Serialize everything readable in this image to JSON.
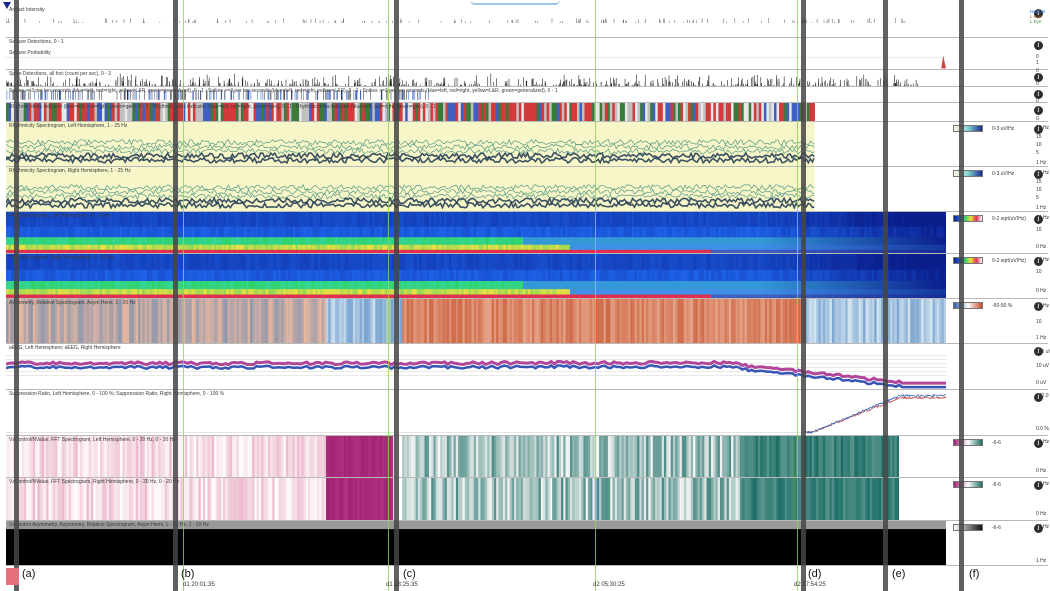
{
  "panels": [
    {
      "id": "artifact",
      "title": "Artifact Intensity",
      "ticks": []
    },
    {
      "id": "seizure",
      "title": "Seizure Detections, 0 - 1",
      "title2": "Seizure Probability",
      "ticks": [
        "1",
        "0",
        "1",
        "0"
      ]
    },
    {
      "id": "spike-detect",
      "title": "Spike Detections, all foci (count per sec), 0 - 3",
      "ticks": [
        "3",
        "0"
      ]
    },
    {
      "id": "spikes",
      "title": "Spikes >=3 per ten seconds (blue=left, red=right, yellow=L&R, green=generalized), 0 - 1 ; Spikes >=3 per ten seconds (blue=left, red=right, yellow=L&R), 0 - 1 ; Spikes >=3 per ten seconds (blue=left, red=right, yellow=L&R, green=generalized), 0 - 1",
      "ticks": [
        "1",
        "0"
      ]
    },
    {
      "id": "rhythmic",
      "title": "Rhythmic delta indicator (blue=left, red=right, green=gen), 0 - 1 ; Rhythmic delta indicator (blue=left, red=right, green=gen), 0 - 1 ; Rhythmic delta indicator (blue=left, red=right, green=gen), 0 - 1",
      "ticks": [
        "1",
        "0"
      ]
    },
    {
      "id": "rhythm-left",
      "title": "Rhythmicity Spectrogram, Left Hemisphere, 1 - 25 Hz",
      "ticks": [
        "25 Hz",
        "15",
        "10",
        "5",
        "1 Hz"
      ],
      "scale": "0-3 uV/Hz"
    },
    {
      "id": "rhythm-right",
      "title": "Rhythmicity Spectrogram, Right Hemisphere, 1 - 25 Hz",
      "ticks": [
        "25 Hz",
        "15",
        "10",
        "5",
        "1 Hz"
      ],
      "scale": "0-3 uV/Hz"
    },
    {
      "id": "fft-left",
      "title": "FFT Spectrogram, Left Hemisphere, 0 - 20 Hz",
      "ticks": [
        "20 Hz",
        "10",
        "0 Hz"
      ],
      "scale": "0-2 sqrt(uV/Hz)"
    },
    {
      "id": "fft-right",
      "title": "FFT Spectrogram, Right Hemisphere, 0 - 20 Hz",
      "ticks": [
        "20 Hz",
        "10",
        "0 Hz"
      ],
      "scale": "0-2 sqrt(uV/Hz)"
    },
    {
      "id": "asym",
      "title": "Asymmetry, Relative Spectrogram, Asym Hemi, 1 - 20 Hz",
      "ticks": [
        "20 Hz",
        "10",
        "1 Hz"
      ],
      "scale": "-50-50 %"
    },
    {
      "id": "aeeg",
      "title": "aEEG, Left Hemisphere; aEEG, Right Hemisphere",
      "ticks": [
        "100 uV",
        "10 uV",
        "0 uV"
      ]
    },
    {
      "id": "suppression",
      "title": "Suppression Ratio, Left Hemisphere, 0 - 100 %; Suppression Ratio, Right Hemisphere, 0 - 100 %",
      "ticks": [
        "100.0 %",
        "0.0 %"
      ]
    },
    {
      "id": "vs-left",
      "title": "VsControl/NValue, FFT Spectrogram, Left Hemisphere, 0 - 20 Hz, 0 - 20 Hz",
      "ticks": [
        "20 Hz",
        "0 Hz"
      ],
      "scale": "-6-6"
    },
    {
      "id": "vs-right",
      "title": "VsControl/NValue, FFT Spectrogram, Right Hemisphere, 0 - 20 Hz, 0 - 20 Hz",
      "ticks": [
        "20 Hz",
        "0 Hz"
      ],
      "scale": "-6-6"
    },
    {
      "id": "vs-asym",
      "title": "VsControl Asymmetry, Asymmetry, Relative Spectrogram, Asym Hemi, 1 - 20 Hz, 1 - 20 Hz",
      "ticks": [
        "20 Hz",
        "1 Hz"
      ],
      "scale": "-6-6"
    }
  ],
  "legend": [
    {
      "label": "Reactle",
      "color": "#2a7bd4"
    },
    {
      "label": "L Eye",
      "color": "#b06020"
    },
    {
      "label": "L Eye",
      "color": "#3a9a3a"
    }
  ],
  "markers": [
    {
      "label": "(a)"
    },
    {
      "label": "(b)"
    },
    {
      "label": "(c)"
    },
    {
      "label": "(d)"
    },
    {
      "label": "(e)"
    },
    {
      "label": "(f)"
    }
  ],
  "timestamps": [
    "d1 20:01:35",
    "d1 23:25:35",
    "d2 05:30:25",
    "d2 17:54:25"
  ],
  "colors": {
    "fft_dark": "#0a1e8c",
    "fft_blue": "#1e62e8",
    "fft_green": "#2fd36a",
    "rhythm_bg": "#f6f6c8",
    "rhythm_dark": "#1b3450",
    "asym_red": "#c4502c",
    "asym_blue": "#3a78b8",
    "aeeg_magenta": "#b0479a",
    "aeeg_blue": "#3656b6",
    "vs_magenta": "#a01f72",
    "vs_teal": "#1e6e66",
    "marker_line": "#454545",
    "green_line": "#8fd15a"
  }
}
